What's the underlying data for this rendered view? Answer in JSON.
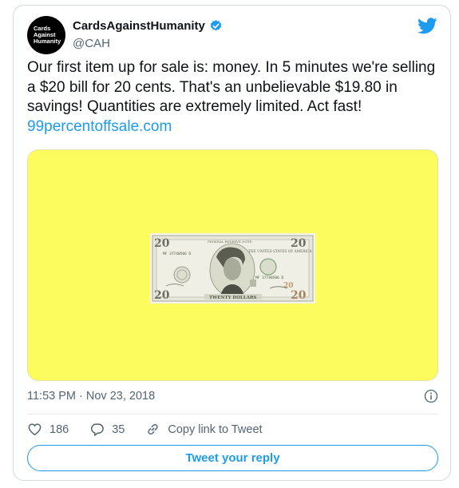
{
  "user": {
    "avatar_lines": [
      "Cards",
      "Against",
      "Humanity"
    ],
    "display_name": "CardsAgainstHumanity",
    "handle": "@CAH"
  },
  "tweet": {
    "text": "Our first item up for sale is: money. In 5 minutes we're selling a $20 bill for 20 cents. That's an unbelievable $19.80 in savings! Quantities are extremely limited. Act fast! ",
    "link": "99percentoffsale.com",
    "timestamp": "11:53 PM · Nov 23, 2018"
  },
  "media": {
    "background": "#fcfc5e",
    "bill": {
      "denomination": "20",
      "country": "THE UNITED STATES OF AMERICA",
      "footer": "TWENTY DOLLARS",
      "serial": "MF 37740506 D",
      "top_center": "FEDERAL RESERVE NOTE"
    }
  },
  "actions": {
    "likes": "186",
    "replies": "35",
    "copy_link": "Copy link to Tweet"
  },
  "reply_button": "Tweet your reply",
  "colors": {
    "accent": "#1d9bf0",
    "muted": "#536471"
  },
  "icons": [
    "verified-badge-icon",
    "twitter-bird-icon",
    "info-icon",
    "heart-icon",
    "reply-icon",
    "link-icon"
  ]
}
